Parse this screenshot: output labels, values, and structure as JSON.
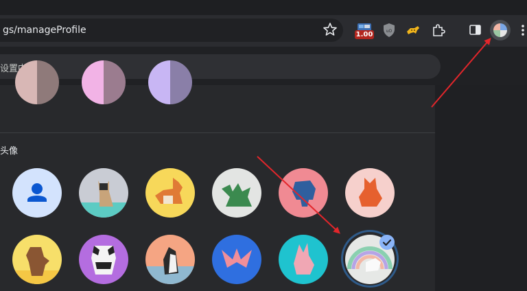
{
  "browser": {
    "url_text": "gs/manageProfile",
    "bookmark_icon": "star-icon",
    "extension_badge": "1.00",
    "profile_icon": "profile-avatar-icon"
  },
  "settings": {
    "search_placeholder": "设置中搜索"
  },
  "avatar_section": {
    "title": "头像",
    "selected_index": 11,
    "avatars": [
      {
        "name": "default-person-icon"
      },
      {
        "name": "cat-origami-icon"
      },
      {
        "name": "corgi-origami-icon"
      },
      {
        "name": "dragon-origami-icon"
      },
      {
        "name": "elephant-origami-icon"
      },
      {
        "name": "fox-origami-icon"
      },
      {
        "name": "monkey-origami-icon"
      },
      {
        "name": "panda-origami-icon"
      },
      {
        "name": "penguin-origami-icon"
      },
      {
        "name": "butterfly-origami-icon"
      },
      {
        "name": "rabbit-origami-icon"
      },
      {
        "name": "unicorn-origami-icon"
      }
    ]
  },
  "colors": {
    "accent": "#8ab4f8",
    "arrow": "#e3262b"
  }
}
